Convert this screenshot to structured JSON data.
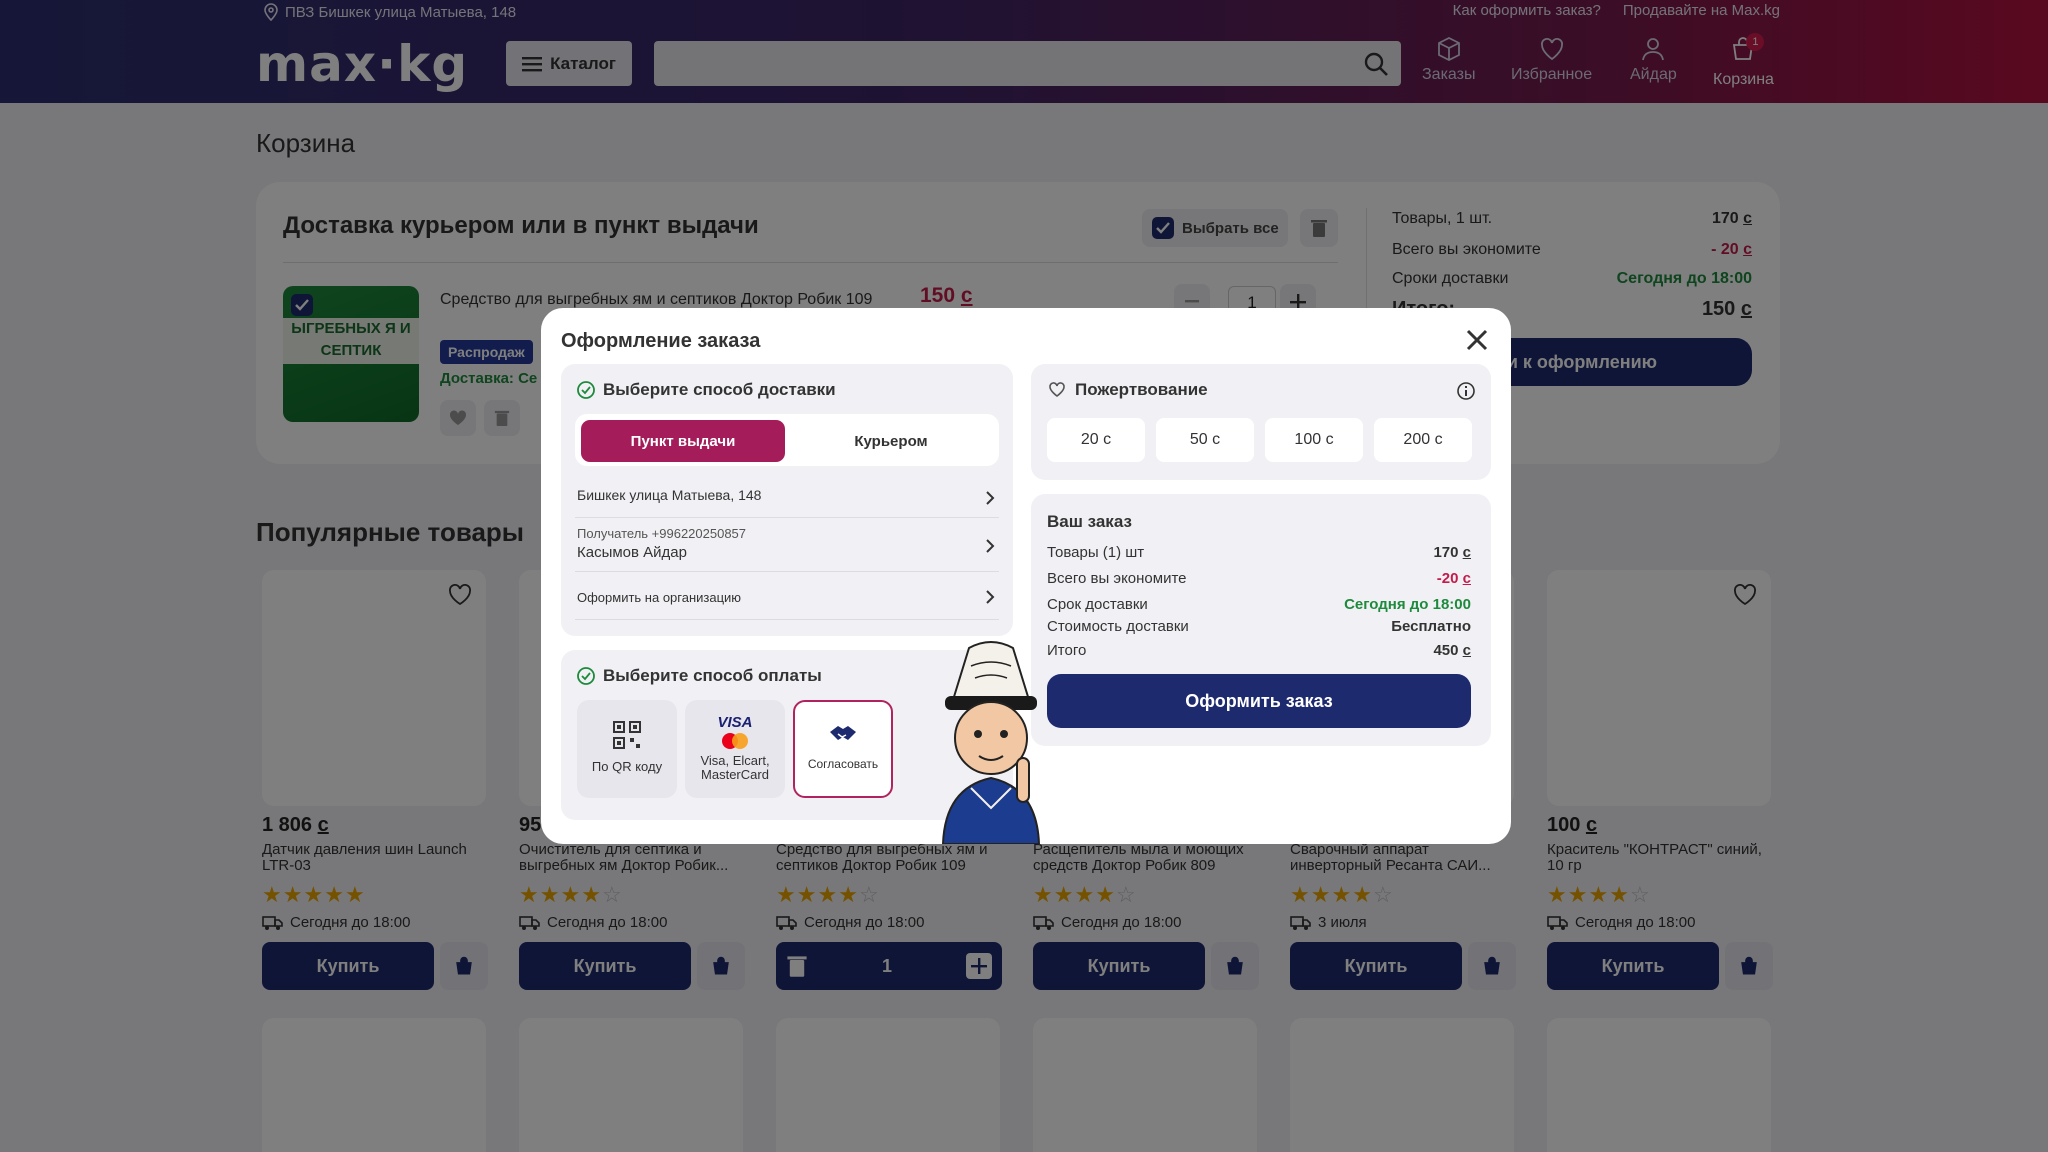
{
  "header": {
    "location": "ПВЗ Бишкек улица Матыева, 148",
    "links": [
      "Как оформить заказ?",
      "Продавайте на Max.kg"
    ],
    "logo": "max·kg",
    "catalog_label": "Каталог",
    "search_placeholder": "",
    "nav": [
      {
        "label": "Заказы",
        "icon": "box-icon"
      },
      {
        "label": "Избранное",
        "icon": "heart-icon"
      },
      {
        "label": "Айдар",
        "icon": "user-icon"
      },
      {
        "label": "Корзина",
        "icon": "cart-icon",
        "badge": "1"
      }
    ]
  },
  "page": {
    "title": "Корзина"
  },
  "cart": {
    "section_title": "Доставка курьером или в пункт выдачи",
    "select_all": "Выбрать все",
    "item": {
      "name": "Средство для выгребных ям и септиков Доктор Робик 109",
      "price": "150",
      "currency": "с",
      "badge": "Распродаж",
      "delivery": "Доставка: Се",
      "qty": "1",
      "image_text": "ЫГРЕБНЫХ Я И СЕПТИК"
    },
    "summary": {
      "rows": [
        {
          "label": "Товары, 1 шт.",
          "value": "170",
          "currency": "с"
        },
        {
          "label": "Всего вы экономите",
          "value": "- 20",
          "currency": "с"
        },
        {
          "label": "Сроки доставки",
          "value": "Сегодня до 18:00",
          "currency": ""
        }
      ],
      "total_label": "Итого:",
      "total_value": "150",
      "total_currency": "с",
      "checkout_label": "йти к оформлению"
    }
  },
  "popular": {
    "title": "Популярные товары",
    "products": [
      {
        "price": "1 806",
        "currency": "с",
        "name": "Датчик давления шин Launch LTR-03",
        "stars": 5,
        "delivery": "Сегодня до 18:00",
        "buy": "Купить"
      },
      {
        "price": "95",
        "currency": "",
        "name": "Очиститель для септика и выгребных ям Доктор Робик...",
        "stars": 4,
        "delivery": "Сегодня до 18:00",
        "buy": "Купить"
      },
      {
        "price": "",
        "currency": "",
        "name": "Средство для выгребных ям и септиков Доктор Робик 109",
        "stars": 4,
        "delivery": "Сегодня до 18:00",
        "qty": "1"
      },
      {
        "price": "",
        "currency": "",
        "name": "Расщепитель мыла и моющих средств Доктор Робик 809",
        "stars": 4,
        "delivery": "Сегодня до 18:00",
        "buy": "Купить"
      },
      {
        "price": "",
        "currency": "",
        "name": "Сварочный аппарат инверторный Ресанта САИ...",
        "stars": 4,
        "delivery": "3 июля",
        "buy": "Купить"
      },
      {
        "price": "100",
        "currency": "с",
        "name": "Краситель \"КОНТРАСТ\" синий, 10 гр",
        "stars": 4,
        "delivery": "Сегодня до 18:00",
        "buy": "Купить"
      }
    ]
  },
  "modal": {
    "title": "Оформление заказа",
    "delivery": {
      "heading": "Выберите способ доставки",
      "options": [
        "Пункт выдачи",
        "Курьером"
      ],
      "address": "Бишкек улица Матыева, 148",
      "recipient_label": "Получатель +996220250857",
      "recipient_name": "Касымов Айдар",
      "org": "Оформить на организацию"
    },
    "payment": {
      "heading": "Выберите способ оплаты",
      "options": [
        "По QR коду",
        "Visa, Elcart, MasterCard",
        "Согласовать"
      ],
      "visa_logo": "VISA"
    },
    "donation": {
      "heading": "Пожертвование",
      "amounts": [
        "20 с",
        "50 с",
        "100 с",
        "200 с"
      ]
    },
    "order": {
      "heading": "Ваш заказ",
      "rows": [
        {
          "label": "Товары (1) шт",
          "value": "170",
          "currency": "с"
        },
        {
          "label": "Всего вы экономите",
          "value": "-20",
          "currency": "с"
        },
        {
          "label": "Срок доставки",
          "value": "Сегодня до 18:00",
          "currency": ""
        },
        {
          "label": "Стоимость доставки",
          "value": "Бесплатно",
          "currency": ""
        },
        {
          "label": "Итого",
          "value": "450",
          "currency": "с"
        }
      ],
      "button": "Оформить заказ"
    }
  },
  "colors": {
    "primary": "#1e2a6e",
    "accent": "#a41d5a",
    "green": "#1e8a3c",
    "red": "#c31c4a"
  }
}
